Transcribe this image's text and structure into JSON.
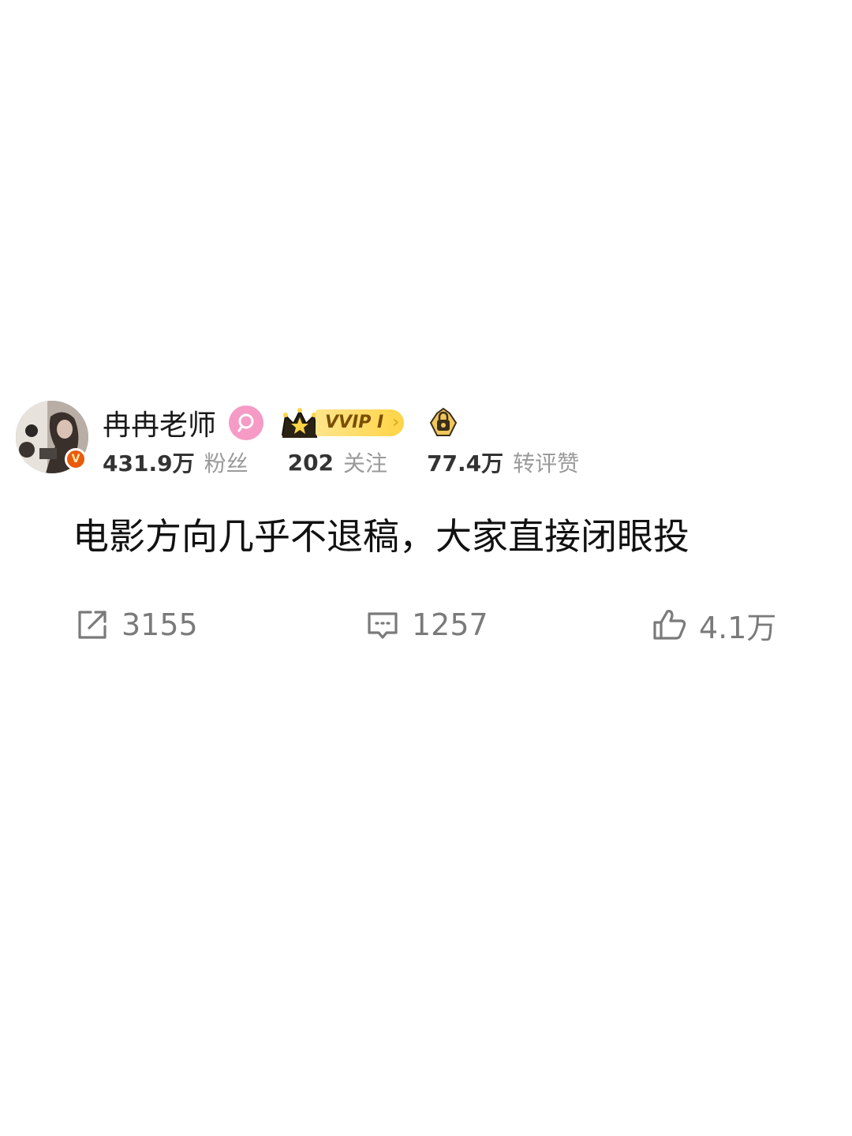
{
  "user": {
    "name": "冉冉老师",
    "verified_mark": "V",
    "vip_label": "VVIP I",
    "followers_count": "431.9万",
    "followers_label": "粉丝",
    "following_count": "202",
    "following_label": "关注",
    "engagement_count": "77.4万",
    "engagement_label": "转评赞"
  },
  "post": {
    "text": "电影方向几乎不退稿，大家直接闭眼投"
  },
  "actions": {
    "repost_count": "3155",
    "comment_count": "1257",
    "like_count": "4.1万"
  },
  "colors": {
    "verified": "#ea5a0c",
    "fan_badge": "#f59bc5",
    "vip_gold": "#ffd447",
    "muted_text": "#9a9a9a"
  },
  "icons": {
    "repost": "share-arrow-icon",
    "comment": "comment-bubble-icon",
    "like": "thumbs-up-icon",
    "fan_badge": "fan-club-icon",
    "vip_crown": "crown-icon",
    "lock": "lock-badge-icon"
  }
}
